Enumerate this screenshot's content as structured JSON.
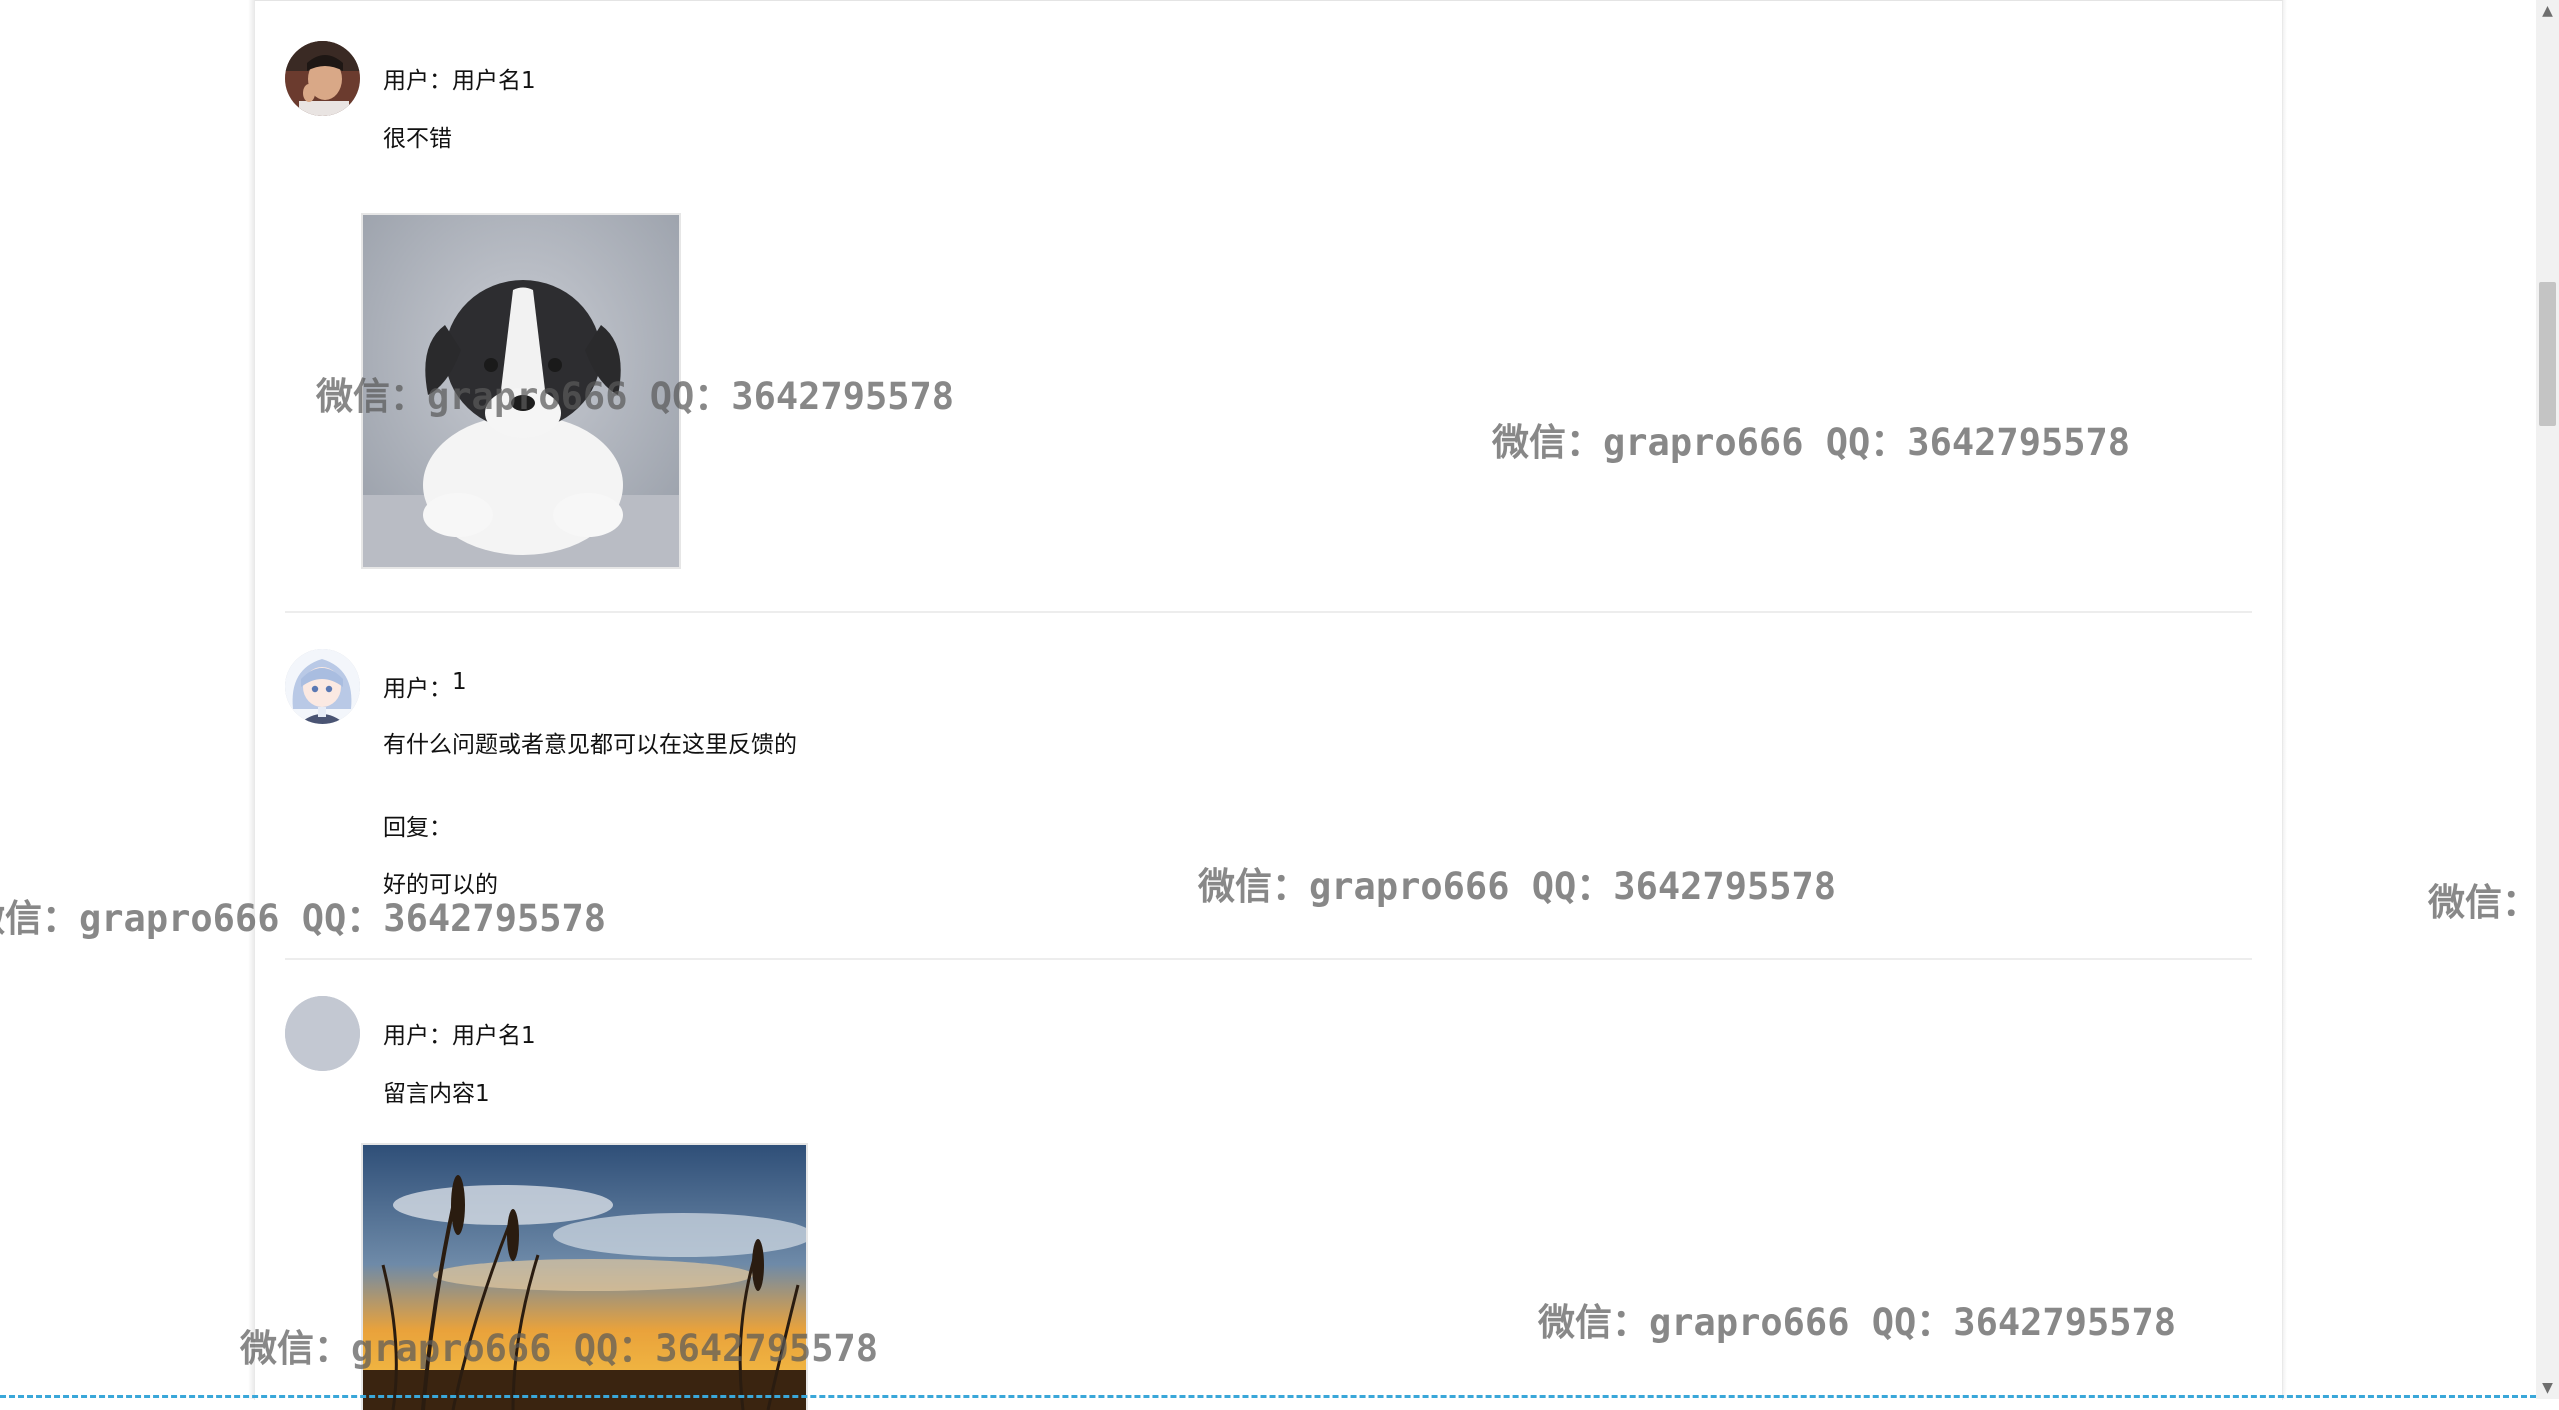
{
  "user_prefix": "用户：",
  "comments": [
    {
      "username": "用户名1",
      "content": "很不错",
      "avatar": "photo-avatar-man",
      "image": "puppy-photo"
    },
    {
      "username": "1",
      "content": "有什么问题或者意见都可以在这里反馈的",
      "avatar": "anime-avatar",
      "reply_label": "回复：",
      "reply_text": "好的可以的"
    },
    {
      "username": "用户名1",
      "content": "留言内容1",
      "avatar": "default-avatar",
      "image": "sunset-grass-photo"
    }
  ],
  "watermark": "微信：grapro666 QQ：3642795578",
  "colors": {
    "divider": "#ededed",
    "accent_dash": "#3aa7d9",
    "watermark": "#5a5a5a"
  }
}
